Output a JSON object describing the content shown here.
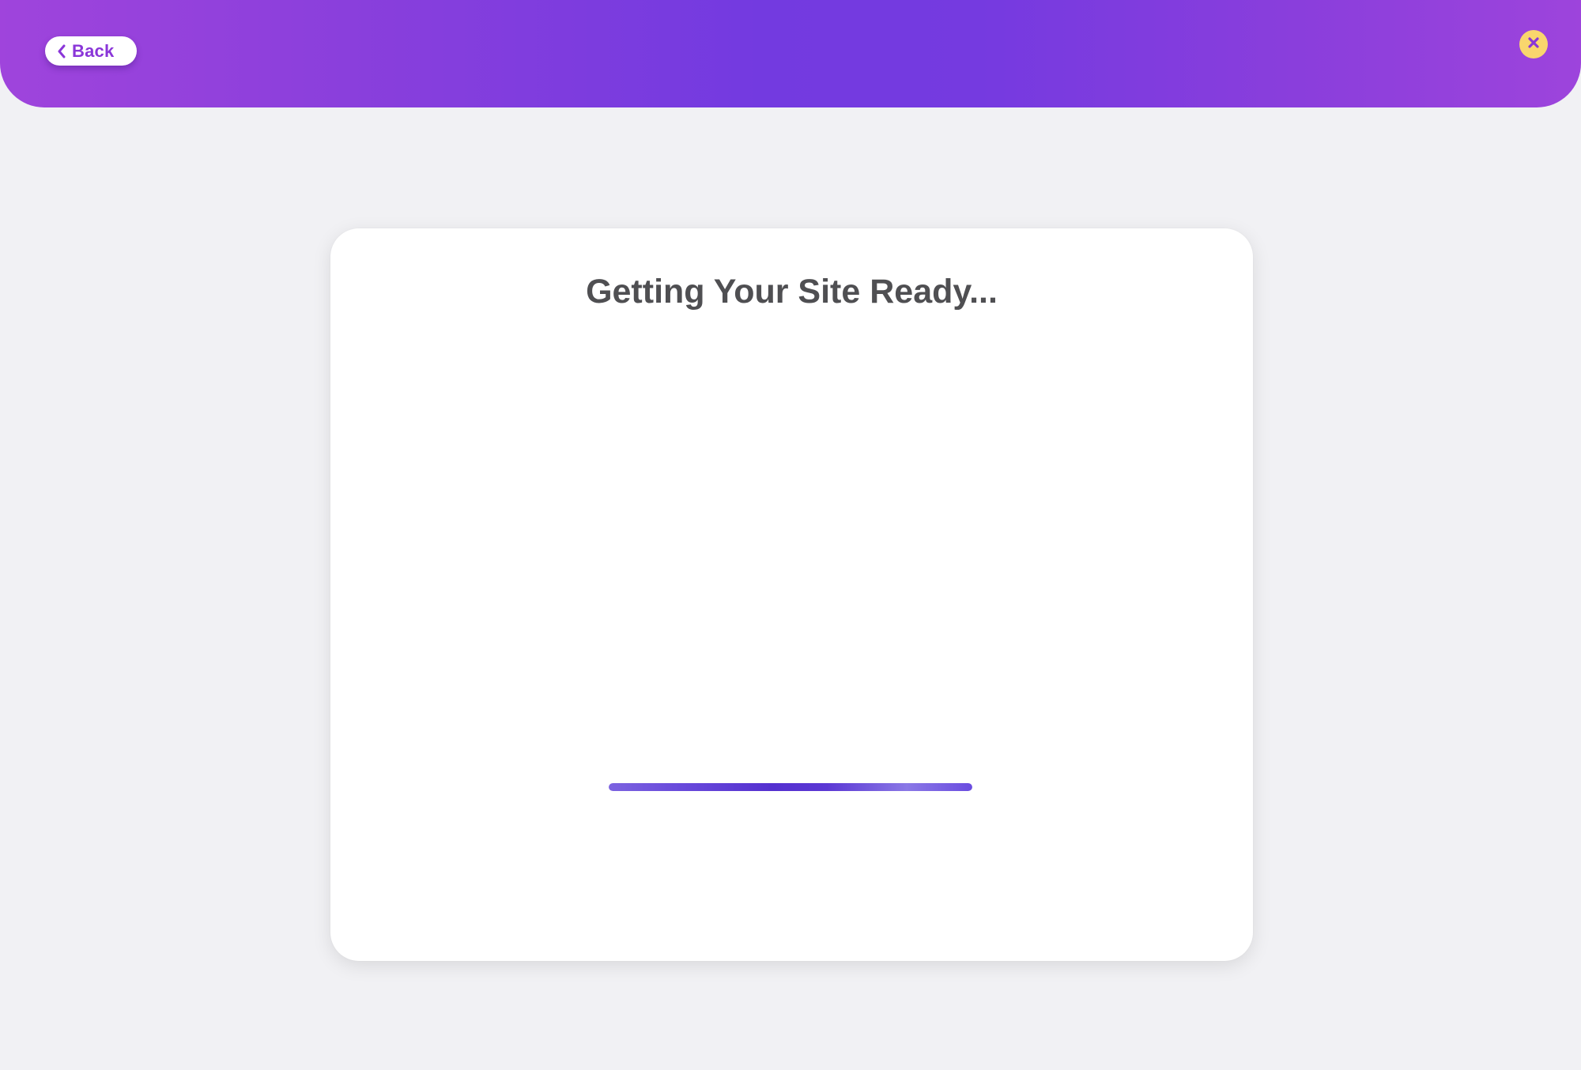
{
  "header": {
    "back_label": "Back",
    "back_icon": "chevron-left-icon",
    "close_icon": "close-icon"
  },
  "card": {
    "title": "Getting Your Site Ready...",
    "progress_fraction": 1.0
  },
  "colors": {
    "header_gradient_start": "#9f44dc",
    "header_gradient_mid": "#733ae0",
    "accent_purple": "#8a36d8",
    "close_button_bg": "#f9d66d",
    "progress_color": "#5430d0",
    "page_background": "#f1f1f4",
    "title_color": "#4f4f52"
  }
}
